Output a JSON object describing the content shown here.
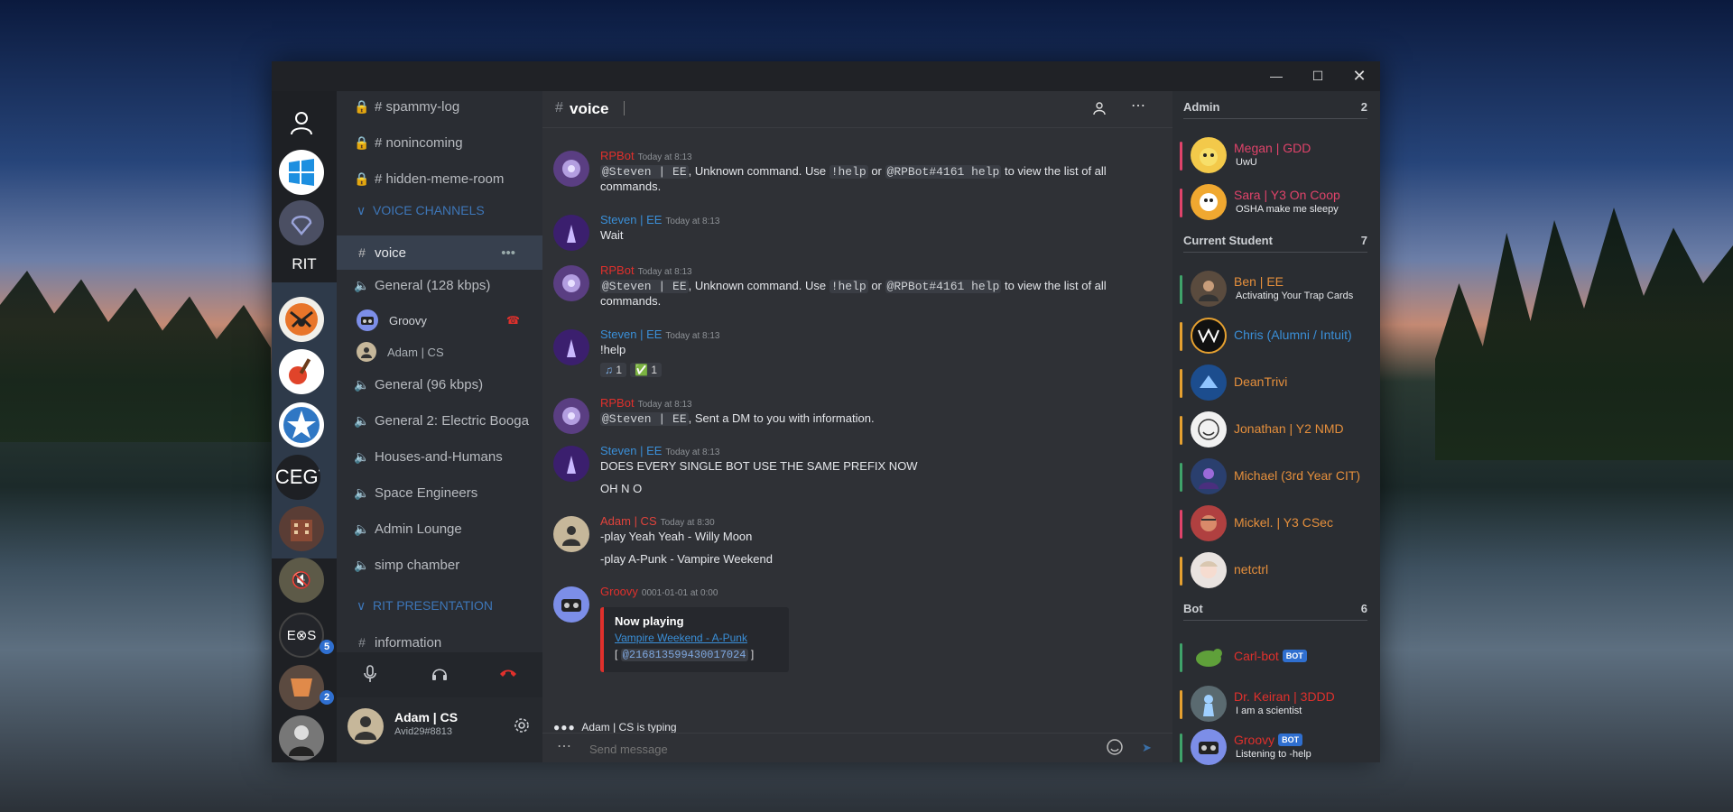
{
  "colors": {
    "rpbot": "#e0302c",
    "steven": "#3a8fd8",
    "adam": "#e0433c",
    "groovy": "#e0302c",
    "admin": "#e0436a",
    "student": "#e58f3c",
    "bot": "#e0302c",
    "accent": "#2f6fd0"
  },
  "guilds": {
    "rit_label": "RIT",
    "cegt_label": "ГСЕGТ",
    "exs_label": "E⊗S",
    "badge_5": "5",
    "badge_2": "2"
  },
  "channels": {
    "locked": [
      "# spammy-log",
      "# nonincoming",
      "# hidden-meme-room"
    ],
    "voice_section": "VOICE CHANNELS",
    "selected": "voice",
    "list": [
      "General (128 kbps)",
      "General (96 kbps)",
      "General 2: Electric Booga",
      "Houses-and-Humans",
      "Space Engineers",
      "Admin Lounge",
      "simp chamber"
    ],
    "voice_users": [
      "Groovy",
      "Adam | CS"
    ],
    "rit_section": "RIT PRESENTATION",
    "information": "information"
  },
  "user": {
    "name": "Adam | CS",
    "tag": "Avid29#8813"
  },
  "chat": {
    "channel_name": "voice",
    "messages": [
      {
        "author": "RPBot",
        "time": "Today at 8:13",
        "mention": "@Steven | EE",
        "t1": ", Unknown command. Use ",
        "c1": "!help",
        "t2": " or ",
        "c2": "@RPBot#4161 help",
        "t3": " to view the list of all commands."
      },
      {
        "author": "Steven | EE",
        "time": "Today at 8:13",
        "text": "Wait"
      },
      {
        "author": "RPBot",
        "time": "Today at 8:13",
        "mention": "@Steven | EE",
        "t1": ", Unknown command. Use ",
        "c1": "!help",
        "t2": " or ",
        "c2": "@RPBot#4161 help",
        "t3": " to view the list of all commands."
      },
      {
        "author": "Steven | EE",
        "time": "Today at 8:13",
        "text": "!help",
        "reactions": [
          "1",
          "1"
        ]
      },
      {
        "author": "RPBot",
        "time": "Today at 8:13",
        "mention": "@Steven | EE",
        "text": ", Sent a DM to you with information."
      },
      {
        "author": "Steven | EE",
        "time": "Today at 8:13",
        "text": "DOES EVERY SINGLE BOT USE THE SAME PREFIX NOW",
        "text2": "OH N O"
      },
      {
        "author": "Adam | CS",
        "time": "Today at 8:30",
        "text": "-play Yeah Yeah - Willy Moon",
        "text2": "-play A-Punk - Vampire Weekend"
      },
      {
        "author": "Groovy",
        "time": "0001-01-01 at 0:00",
        "embed_title": "Now playing",
        "embed_link": "Vampire Weekend - A-Punk",
        "embed_open": "[ ",
        "embed_mention": "@216813599430017024",
        "embed_close": " ]"
      }
    ],
    "typing": "Adam | CS is typing",
    "input_placeholder": "Send message"
  },
  "members": {
    "roles": [
      {
        "name": "Admin",
        "count": "2"
      },
      {
        "name": "Current Student",
        "count": "7"
      },
      {
        "name": "Bot",
        "count": "6"
      }
    ],
    "list": [
      {
        "name": "Megan | GDD",
        "status": "UwU"
      },
      {
        "name": "Sara | Y3 On Coop",
        "status": "OSHA make me sleepy"
      },
      {
        "name": "Ben | EE",
        "status": "Activating Your Trap Cards"
      },
      {
        "name": "Chris (Alumni / Intuit)",
        "status": ""
      },
      {
        "name": "DeanTrivi",
        "status": ""
      },
      {
        "name": "Jonathan | Y2 NMD",
        "status": ""
      },
      {
        "name": "Michael (3rd Year CIT)",
        "status": ""
      },
      {
        "name": "Mickel. | Y3 CSec",
        "status": ""
      },
      {
        "name": "netctrl",
        "status": ""
      },
      {
        "name": "Carl-bot",
        "status": "",
        "bot": "BOT"
      },
      {
        "name": "Dr. Keiran | 3DDD",
        "status": "I am a scientist"
      },
      {
        "name": "Groovy",
        "status": "Listening to -help",
        "bot": "BOT"
      }
    ]
  }
}
